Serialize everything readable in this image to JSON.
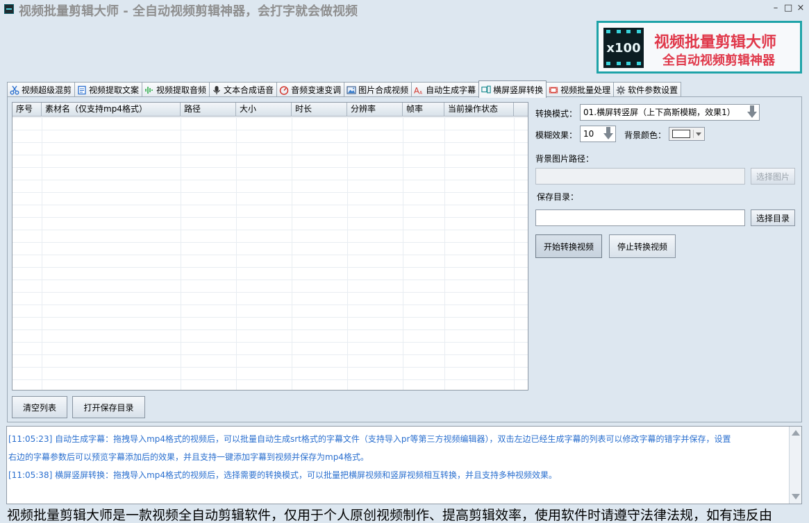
{
  "window": {
    "title": "视频批量剪辑大师 - 全自动视频剪辑神器，会打字就会做视频",
    "controls": [
      "–",
      "□",
      "×"
    ]
  },
  "logo": {
    "badge": "x100",
    "line1": "视频批量剪辑大师",
    "line2": "全自动视频剪辑神器"
  },
  "tabs": [
    {
      "label": "视频超级混剪",
      "icon": "scissors-icon"
    },
    {
      "label": "视频提取文案",
      "icon": "document-icon"
    },
    {
      "label": "视频提取音频",
      "icon": "audio-wave-icon"
    },
    {
      "label": "文本合成语音",
      "icon": "microphone-icon"
    },
    {
      "label": "音频变速变调",
      "icon": "gauge-icon"
    },
    {
      "label": "图片合成视频",
      "icon": "image-icon"
    },
    {
      "label": "自动生成字幕",
      "icon": "font-icon"
    },
    {
      "label": "横屏竖屏转换",
      "icon": "rotate-screen-icon",
      "active": true
    },
    {
      "label": "视频批量处理",
      "icon": "film-icon"
    },
    {
      "label": "软件参数设置",
      "icon": "gear-icon"
    }
  ],
  "table": {
    "columns": [
      "序号",
      "素材名（仅支持mp4格式）",
      "路径",
      "大小",
      "时长",
      "分辨率",
      "帧率",
      "当前操作状态"
    ]
  },
  "buttons": {
    "clear_list": "清空列表",
    "open_save_dir": "打开保存目录",
    "select_image": "选择图片",
    "select_dir": "选择目录",
    "start_convert": "开始转换视频",
    "stop_convert": "停止转换视频"
  },
  "settings": {
    "mode_label": "转换模式：",
    "mode_value": "01.横屏转竖屏（上下高斯模糊，效果1）",
    "blur_label": "模糊效果：",
    "blur_value": "10",
    "bg_color_label": "背景颜色：",
    "bg_color_value": "#ffffff",
    "bg_image_label": "背景图片路径：",
    "bg_image_value": "",
    "save_dir_label": "保存目录：",
    "save_dir_value": ""
  },
  "log": [
    "[11:05:23] 自动生成字幕：拖拽导入mp4格式的视频后，可以批量自动生成srt格式的字幕文件（支持导入pr等第三方视频编辑器），双击左边已经生成字幕的列表可以修改字幕的错字并保存，设置",
    "右边的字幕参数后可以预览字幕添加后的效果，并且支持一键添加字幕到视频并保存为mp4格式。",
    "[11:05:38] 横屏竖屏转换：拖拽导入mp4格式的视频后，选择需要的转换模式，可以批量把横屏视频和竖屏视频相互转换，并且支持多种视频效果。"
  ],
  "marquee": "视频批量剪辑大师是一款视频全自动剪辑软件，仅用于个人原创视频制作、提高剪辑效率，使用软件时请遵守法律法规，如有违反由"
}
